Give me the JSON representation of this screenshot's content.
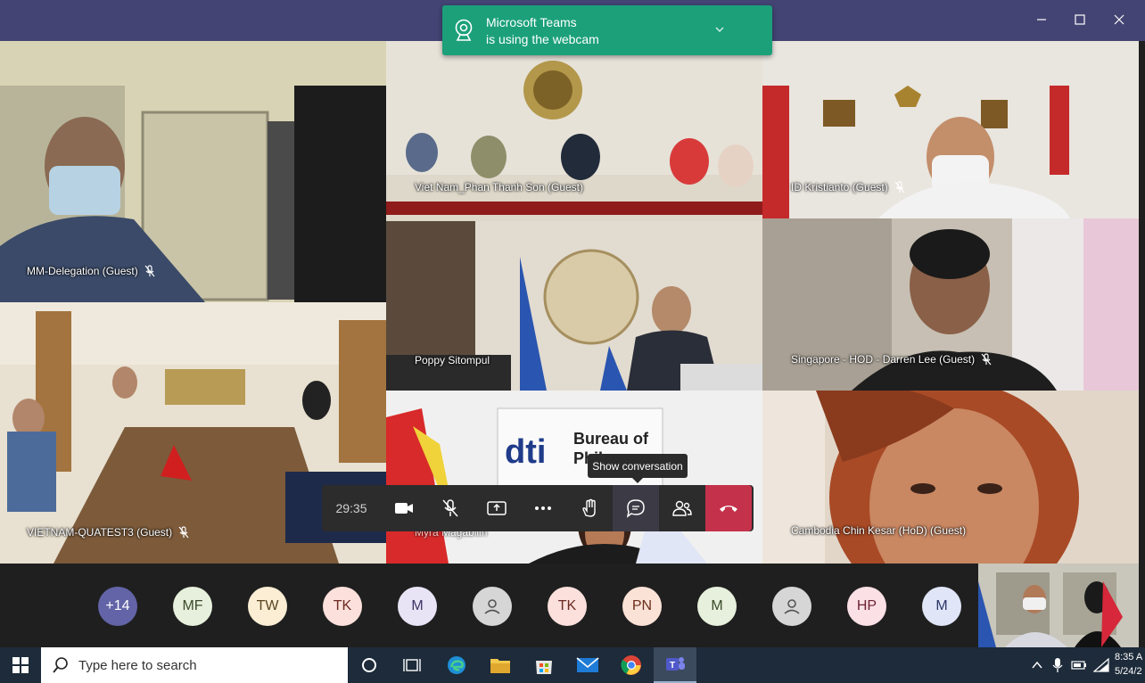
{
  "toast": {
    "line1": "Microsoft Teams",
    "line2": "is using the webcam"
  },
  "tiles": {
    "mm_delegation": "MM-Delegation (Guest)",
    "vietnam_phan": "Viet Nam_Phan Thanh Son (Guest)",
    "id_kristianto": "ID Kristianto (Guest)",
    "poppy": "Poppy Sitompul",
    "singapore": "Singapore - HOD - Darren Lee (Guest)",
    "vietnam_quatest": "VIETNAM-QUATEST3 (Guest)",
    "myra": "Myra Magabilin",
    "cambodia": "Cambodia Chin Kesar (HoD) (Guest)"
  },
  "dti_sign": {
    "logo": "dti",
    "line1": "Bureau of",
    "line2": "Phil"
  },
  "controls": {
    "timer": "29:35",
    "tooltip": "Show conversation"
  },
  "participants": [
    {
      "initials": "+14",
      "bg": "#6264a7",
      "fg": "#ffffff"
    },
    {
      "initials": "MF",
      "bg": "#e7f0dc",
      "fg": "#3a4a2a"
    },
    {
      "initials": "TW",
      "bg": "#fbeed4",
      "fg": "#5a4520"
    },
    {
      "initials": "TK",
      "bg": "#fbe0dc",
      "fg": "#6b2a22"
    },
    {
      "initials": "M",
      "bg": "#e8e4f5",
      "fg": "#3e3566"
    },
    {
      "initials": "",
      "bg": "#d6d6d6",
      "fg": "#555555",
      "icon": "person-icon"
    },
    {
      "initials": "TK",
      "bg": "#fbe0dc",
      "fg": "#6b2a22"
    },
    {
      "initials": "PN",
      "bg": "#fbe2d7",
      "fg": "#6b2f1d"
    },
    {
      "initials": "M",
      "bg": "#e7f0dc",
      "fg": "#3a4a2a"
    },
    {
      "initials": "",
      "bg": "#d6d6d6",
      "fg": "#555555",
      "icon": "person-icon"
    },
    {
      "initials": "HP",
      "bg": "#fbe0e6",
      "fg": "#6b2233"
    },
    {
      "initials": "M",
      "bg": "#e0e6f8",
      "fg": "#2b3566"
    }
  ],
  "taskbar": {
    "search_placeholder": "Type here to search",
    "time": "8:35 A",
    "date": "5/24/2"
  }
}
